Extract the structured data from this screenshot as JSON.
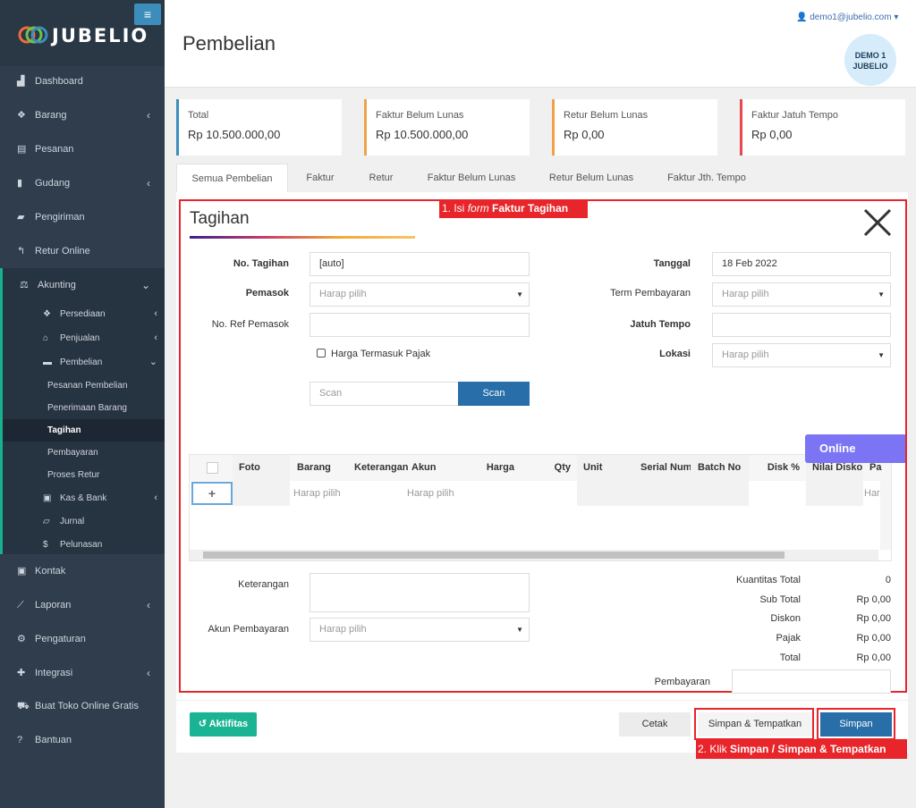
{
  "app": {
    "name": "JUBELIO",
    "menu_icon": "≡"
  },
  "sidebar": {
    "items": [
      {
        "label": "Dashboard",
        "icon": "chart-icon"
      },
      {
        "label": "Barang",
        "icon": "cubes-icon"
      },
      {
        "label": "Pesanan",
        "icon": "basket-icon"
      },
      {
        "label": "Gudang",
        "icon": "building-icon"
      },
      {
        "label": "Pengiriman",
        "icon": "truck-icon"
      },
      {
        "label": "Retur Online",
        "icon": "reply-icon"
      },
      {
        "label": "Akunting",
        "icon": "scale-icon"
      }
    ],
    "akunting_sub": [
      {
        "label": "Persediaan"
      },
      {
        "label": "Penjualan"
      },
      {
        "label": "Pembelian"
      }
    ],
    "pembelian_leaves": [
      "Pesanan Pembelian",
      "Penerimaan Barang",
      "Tagihan",
      "Pembayaran",
      "Proses Retur"
    ],
    "akunting_more": [
      {
        "label": "Kas & Bank"
      },
      {
        "label": "Jurnal"
      },
      {
        "label": "Pelunasan"
      }
    ],
    "bottom": [
      {
        "label": "Kontak"
      },
      {
        "label": "Laporan"
      },
      {
        "label": "Pengaturan"
      },
      {
        "label": "Integrasi"
      },
      {
        "label": "Buat Toko Online Gratis"
      },
      {
        "label": "Bantuan"
      }
    ]
  },
  "header": {
    "title": "Pembelian",
    "user": "demo1@jubelio.com",
    "avatar_line1": "DEMO 1",
    "avatar_line2": "JUBELIO"
  },
  "cards": [
    {
      "label": "Total",
      "value": "Rp 10.500.000,00",
      "color": "#3c8dbc"
    },
    {
      "label": "Faktur Belum Lunas",
      "value": "Rp 10.500.000,00",
      "color": "#f0a24a"
    },
    {
      "label": "Retur Belum Lunas",
      "value": "Rp 0,00",
      "color": "#f0a24a"
    },
    {
      "label": "Faktur Jatuh Tempo",
      "value": "Rp 0,00",
      "color": "#e8474c"
    }
  ],
  "tabs": [
    "Semua Pembelian",
    "Faktur",
    "Retur",
    "Faktur Belum Lunas",
    "Retur Belum Lunas",
    "Faktur Jth. Tempo"
  ],
  "form": {
    "title": "Tagihan",
    "annotation_1_prefix": "1. Isi ",
    "annotation_1_em": "form",
    "annotation_1_bold": " Faktur Tagihan",
    "no_tagihan_label": "No. Tagihan",
    "no_tagihan_value": "[auto]",
    "pemasok_label": "Pemasok",
    "pemasok_placeholder": "Harap pilih",
    "no_ref_label": "No. Ref Pemasok",
    "harga_pajak_label": "Harga Termasuk Pajak",
    "scan_placeholder": "Scan",
    "scan_button": "Scan",
    "tanggal_label": "Tanggal",
    "tanggal_value": "18 Feb 2022",
    "term_label": "Term Pembayaran",
    "term_placeholder": "Harap pilih",
    "jatuh_tempo_label": "Jatuh Tempo",
    "lokasi_label": "Lokasi",
    "lokasi_placeholder": "Harap pilih"
  },
  "online_badge": "Online",
  "table": {
    "headers": [
      "Foto",
      "Barang",
      "Keterangan",
      "Akun",
      "Harga",
      "Qty",
      "Unit",
      "Serial Number",
      "Batch No",
      "Disk %",
      "Nilai Diskon",
      "Pa"
    ],
    "row": {
      "add": "+",
      "barang": "Harap pilih",
      "akun": "Harap pilih",
      "last": "Har"
    }
  },
  "bottom_form": {
    "keterangan_label": "Keterangan",
    "akun_pembayaran_label": "Akun Pembayaran",
    "akun_pembayaran_placeholder": "Harap pilih",
    "pembayaran_label": "Pembayaran"
  },
  "totals": [
    {
      "label": "Kuantitas Total",
      "value": "0"
    },
    {
      "label": "Sub Total",
      "value": "Rp 0,00"
    },
    {
      "label": "Diskon",
      "value": "Rp 0,00"
    },
    {
      "label": "Pajak",
      "value": "Rp 0,00"
    },
    {
      "label": "Total",
      "value": "Rp 0,00"
    }
  ],
  "buttons": {
    "aktifitas": "Aktifitas",
    "cetak": "Cetak",
    "simpan_tempatkan": "Simpan & Tempatkan",
    "simpan": "Simpan"
  },
  "annotation_2_prefix": "2. Klik ",
  "annotation_2_bold": "Simpan / Simpan & Tempatkan"
}
